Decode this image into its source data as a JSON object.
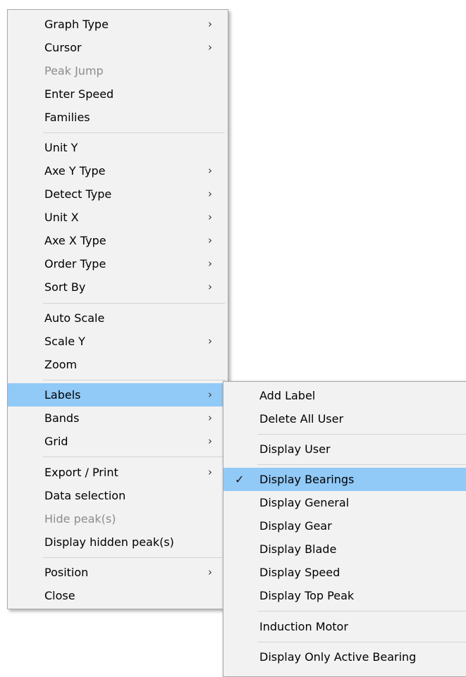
{
  "main_menu": {
    "items": [
      {
        "label": "Graph Type",
        "has_submenu": true,
        "disabled": false
      },
      {
        "label": "Cursor",
        "has_submenu": true,
        "disabled": false
      },
      {
        "label": "Peak Jump",
        "has_submenu": false,
        "disabled": true
      },
      {
        "label": "Enter Speed",
        "has_submenu": false,
        "disabled": false
      },
      {
        "label": "Families",
        "has_submenu": false,
        "disabled": false
      },
      {
        "label": "Unit Y",
        "has_submenu": false,
        "disabled": false
      },
      {
        "label": "Axe Y Type",
        "has_submenu": true,
        "disabled": false
      },
      {
        "label": "Detect Type",
        "has_submenu": true,
        "disabled": false
      },
      {
        "label": "Unit X",
        "has_submenu": true,
        "disabled": false
      },
      {
        "label": "Axe X Type",
        "has_submenu": true,
        "disabled": false
      },
      {
        "label": "Order Type",
        "has_submenu": true,
        "disabled": false
      },
      {
        "label": "Sort By",
        "has_submenu": true,
        "disabled": false
      },
      {
        "label": "Auto Scale",
        "has_submenu": false,
        "disabled": false
      },
      {
        "label": "Scale Y",
        "has_submenu": true,
        "disabled": false
      },
      {
        "label": "Zoom",
        "has_submenu": false,
        "disabled": false
      },
      {
        "label": "Labels",
        "has_submenu": true,
        "disabled": false,
        "highlighted": true
      },
      {
        "label": "Bands",
        "has_submenu": true,
        "disabled": false
      },
      {
        "label": "Grid",
        "has_submenu": true,
        "disabled": false
      },
      {
        "label": "Export / Print",
        "has_submenu": true,
        "disabled": false
      },
      {
        "label": "Data selection",
        "has_submenu": false,
        "disabled": false
      },
      {
        "label": "Hide peak(s)",
        "has_submenu": false,
        "disabled": true
      },
      {
        "label": "Display hidden peak(s)",
        "has_submenu": false,
        "disabled": false
      },
      {
        "label": "Position",
        "has_submenu": true,
        "disabled": false
      },
      {
        "label": "Close",
        "has_submenu": false,
        "disabled": false
      }
    ]
  },
  "labels_submenu": {
    "items": [
      {
        "label": "Add Label",
        "checked": false
      },
      {
        "label": "Delete All User",
        "checked": false
      },
      {
        "label": "Display User",
        "checked": false
      },
      {
        "label": "Display Bearings",
        "checked": true,
        "highlighted": true
      },
      {
        "label": "Display General",
        "checked": false
      },
      {
        "label": "Display Gear",
        "checked": false
      },
      {
        "label": "Display Blade",
        "checked": false
      },
      {
        "label": "Display Speed",
        "checked": false
      },
      {
        "label": "Display Top Peak",
        "checked": false
      },
      {
        "label": "Induction Motor",
        "checked": false
      },
      {
        "label": "Display Only Active Bearing",
        "checked": false
      }
    ]
  },
  "glyphs": {
    "submenu_arrow": "›",
    "checkmark": "✓"
  },
  "colors": {
    "menu_background": "#f2f2f2",
    "highlight": "#91c9f7",
    "disabled_text": "#8c8c8c",
    "separator": "#d4d4d4"
  }
}
